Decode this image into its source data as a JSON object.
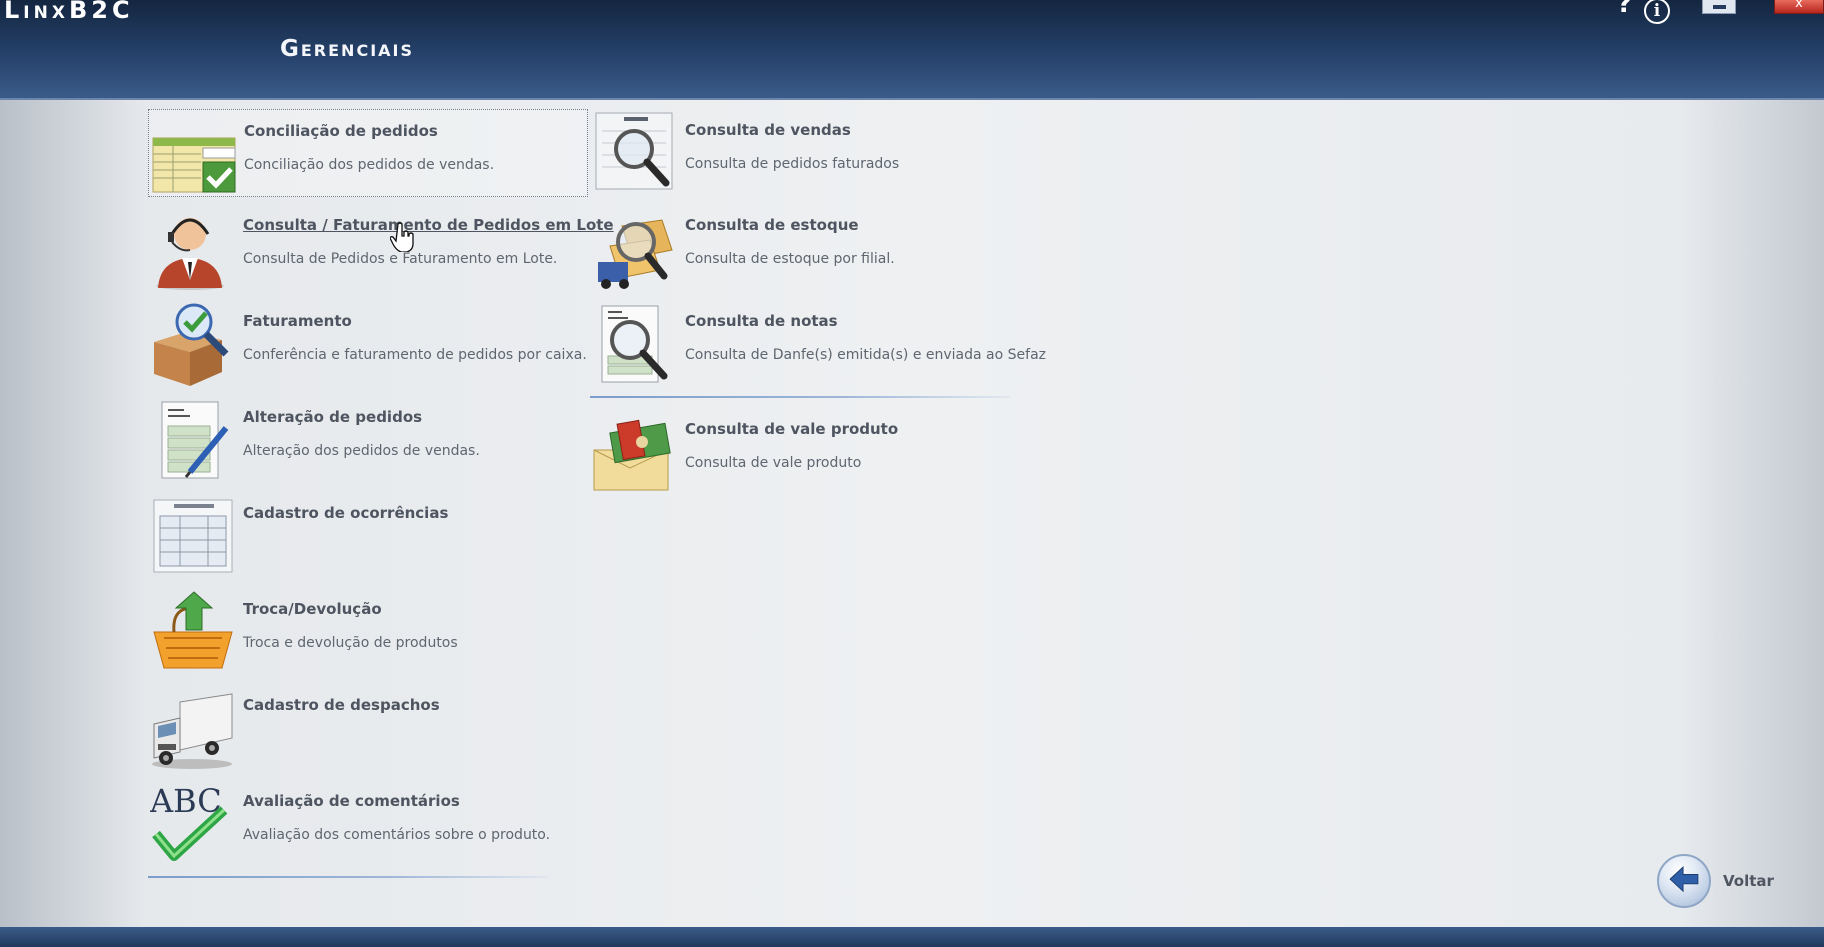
{
  "app": {
    "brand": "LinxB2C",
    "title": "Gerenciais"
  },
  "window_controls": {
    "help": "?",
    "info": "i",
    "close": "x"
  },
  "menu_left": [
    {
      "title": "Conciliação de pedidos",
      "description": "Conciliação dos pedidos de vendas.",
      "icon": "reconcile-icon"
    },
    {
      "title": "Consulta / Faturamento de Pedidos em Lote",
      "description": "Consulta de Pedidos e Faturamento em Lote.",
      "icon": "operator-icon"
    },
    {
      "title": "Faturamento",
      "description": "Conferência e faturamento de pedidos por caixa.",
      "icon": "box-check-icon"
    },
    {
      "title": "Alteração de pedidos",
      "description": "Alteração dos pedidos de vendas.",
      "icon": "edit-document-icon"
    },
    {
      "title": "Cadastro de ocorrências",
      "description": "",
      "icon": "form-icon"
    },
    {
      "title": "Troca/Devolução",
      "description": "Troca e devolução de produtos",
      "icon": "basket-return-icon"
    },
    {
      "title": "Cadastro de despachos",
      "description": "",
      "icon": "truck-icon"
    },
    {
      "title": "Avaliação de comentários",
      "description": "Avaliação dos comentários sobre o produto.",
      "icon": "abc-check-icon"
    }
  ],
  "menu_right": [
    {
      "title": "Consulta de vendas",
      "description": "Consulta de pedidos faturados",
      "icon": "sales-search-icon"
    },
    {
      "title": "Consulta de estoque",
      "description": "Consulta de estoque por filial.",
      "icon": "stock-search-icon"
    },
    {
      "title": "Consulta de notas",
      "description": "Consulta de Danfe(s) emitida(s) e enviada ao Sefaz",
      "icon": "invoice-search-icon"
    },
    {
      "title": "Consulta de vale produto",
      "description": "Consulta de vale produto",
      "icon": "voucher-icon"
    }
  ],
  "back": {
    "label": "Voltar"
  },
  "colors": {
    "header_top": "#142640",
    "header_bottom": "#3a5b89",
    "text_title": "#4e5560",
    "text_desc": "#5f6670"
  }
}
